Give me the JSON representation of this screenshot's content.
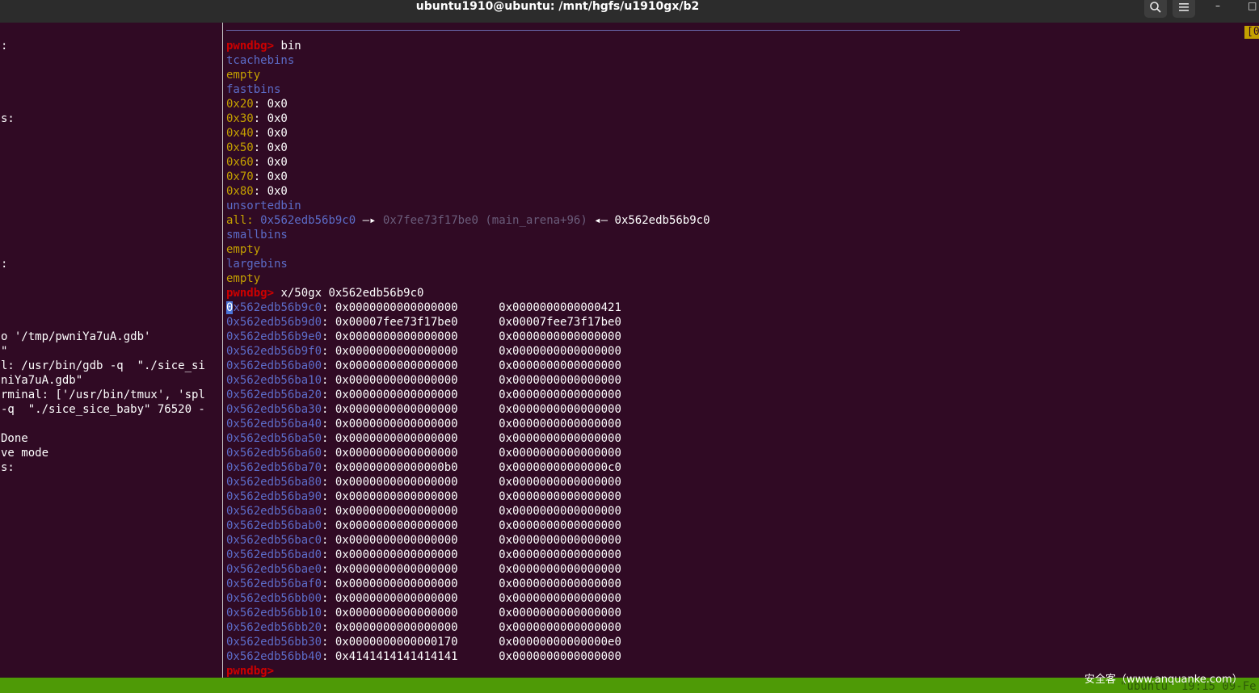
{
  "window": {
    "title": "ubuntu1910@ubuntu: /mnt/hgfs/u1910gx/b2",
    "search_icon": "search-icon",
    "menu_icon": "hamburger-menu-icon",
    "minimize_glyph": "–",
    "maximize_glyph": "□"
  },
  "corner_tag": "[0",
  "left_pane": [
    ":",
    "",
    "",
    "",
    "",
    "s:",
    "",
    "",
    "",
    "",
    "",
    "",
    "",
    "",
    "",
    ":",
    "",
    "",
    "",
    "",
    "o '/tmp/pwniYa7uA.gdb'",
    "\"",
    "l: /usr/bin/gdb -q  \"./sice_si",
    "niYa7uA.gdb\"",
    "rminal: ['/usr/bin/tmux', 'spl",
    "-q  \"./sice_sice_baby\" 76520 -",
    "",
    "Done",
    "ve mode",
    "s:"
  ],
  "prompt": "pwndbg>",
  "command1": " bin",
  "bins": {
    "tcache_header": "tcachebins",
    "tcache_value": "empty",
    "fast_header": "fastbins",
    "fast_rows": [
      {
        "size": "0x20",
        "value": "0x0"
      },
      {
        "size": "0x30",
        "value": "0x0"
      },
      {
        "size": "0x40",
        "value": "0x0"
      },
      {
        "size": "0x50",
        "value": "0x0"
      },
      {
        "size": "0x60",
        "value": "0x0"
      },
      {
        "size": "0x70",
        "value": "0x0"
      },
      {
        "size": "0x80",
        "value": "0x0"
      }
    ],
    "unsorted_header": "unsortedbin",
    "unsorted_label": "all:",
    "unsorted_addr1": "0x562edb56b9c0",
    "unsorted_arrow1": "—▸",
    "unsorted_addr2": "0x7fee73f17be0 (main_arena+96)",
    "unsorted_arrow2": "◂—",
    "unsorted_addr3": "0x562edb56b9c0",
    "small_header": "smallbins",
    "small_value": "empty",
    "large_header": "largebins",
    "large_value": "empty"
  },
  "command2": " x/50gx 0x562edb56b9c0",
  "memory": [
    {
      "addr": "0x562edb56b9c0",
      "v1": "0x0000000000000000",
      "v2": "0x0000000000000421"
    },
    {
      "addr": "0x562edb56b9d0",
      "v1": "0x00007fee73f17be0",
      "v2": "0x00007fee73f17be0"
    },
    {
      "addr": "0x562edb56b9e0",
      "v1": "0x0000000000000000",
      "v2": "0x0000000000000000"
    },
    {
      "addr": "0x562edb56b9f0",
      "v1": "0x0000000000000000",
      "v2": "0x0000000000000000"
    },
    {
      "addr": "0x562edb56ba00",
      "v1": "0x0000000000000000",
      "v2": "0x0000000000000000"
    },
    {
      "addr": "0x562edb56ba10",
      "v1": "0x0000000000000000",
      "v2": "0x0000000000000000"
    },
    {
      "addr": "0x562edb56ba20",
      "v1": "0x0000000000000000",
      "v2": "0x0000000000000000"
    },
    {
      "addr": "0x562edb56ba30",
      "v1": "0x0000000000000000",
      "v2": "0x0000000000000000"
    },
    {
      "addr": "0x562edb56ba40",
      "v1": "0x0000000000000000",
      "v2": "0x0000000000000000"
    },
    {
      "addr": "0x562edb56ba50",
      "v1": "0x0000000000000000",
      "v2": "0x0000000000000000"
    },
    {
      "addr": "0x562edb56ba60",
      "v1": "0x0000000000000000",
      "v2": "0x0000000000000000"
    },
    {
      "addr": "0x562edb56ba70",
      "v1": "0x00000000000000b0",
      "v2": "0x00000000000000c0"
    },
    {
      "addr": "0x562edb56ba80",
      "v1": "0x0000000000000000",
      "v2": "0x0000000000000000"
    },
    {
      "addr": "0x562edb56ba90",
      "v1": "0x0000000000000000",
      "v2": "0x0000000000000000"
    },
    {
      "addr": "0x562edb56baa0",
      "v1": "0x0000000000000000",
      "v2": "0x0000000000000000"
    },
    {
      "addr": "0x562edb56bab0",
      "v1": "0x0000000000000000",
      "v2": "0x0000000000000000"
    },
    {
      "addr": "0x562edb56bac0",
      "v1": "0x0000000000000000",
      "v2": "0x0000000000000000"
    },
    {
      "addr": "0x562edb56bad0",
      "v1": "0x0000000000000000",
      "v2": "0x0000000000000000"
    },
    {
      "addr": "0x562edb56bae0",
      "v1": "0x0000000000000000",
      "v2": "0x0000000000000000"
    },
    {
      "addr": "0x562edb56baf0",
      "v1": "0x0000000000000000",
      "v2": "0x0000000000000000"
    },
    {
      "addr": "0x562edb56bb00",
      "v1": "0x0000000000000000",
      "v2": "0x0000000000000000"
    },
    {
      "addr": "0x562edb56bb10",
      "v1": "0x0000000000000000",
      "v2": "0x0000000000000000"
    },
    {
      "addr": "0x562edb56bb20",
      "v1": "0x0000000000000000",
      "v2": "0x0000000000000000"
    },
    {
      "addr": "0x562edb56bb30",
      "v1": "0x0000000000000170",
      "v2": "0x00000000000000e0"
    },
    {
      "addr": "0x562edb56bb40",
      "v1": "0x4141414141414141",
      "v2": "0x0000000000000000"
    }
  ],
  "status_bar": {
    "right_text": "\"ubuntu\" 19:15 09-Fe"
  },
  "watermark": "安全客（www.anquanke.com）"
}
